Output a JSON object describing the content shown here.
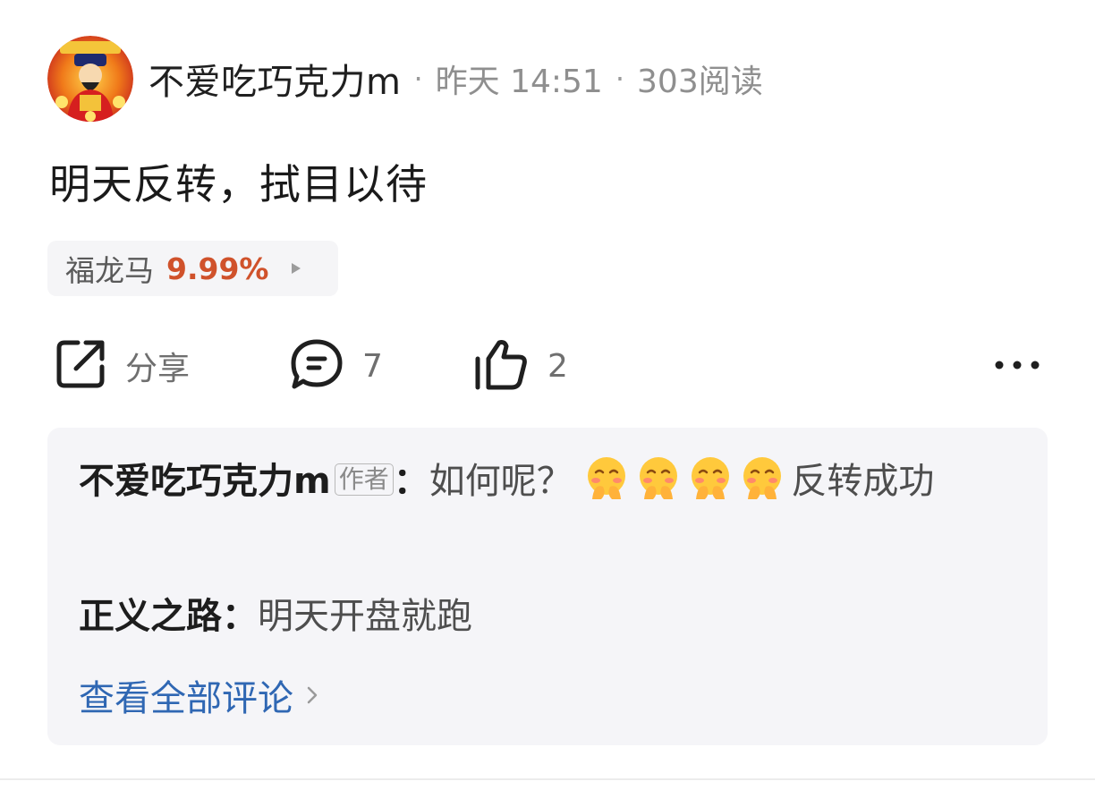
{
  "post": {
    "author": "不爱吃巧克力m",
    "separator": "·",
    "time": "昨天 14:51",
    "reads": "303阅读",
    "content": "明天反转，拭目以待"
  },
  "stock": {
    "name": "福龙马",
    "change": "9.99%",
    "change_color": "#d0522b"
  },
  "actions": {
    "share_label": "分享",
    "comment_count": "7",
    "like_count": "2"
  },
  "comments": [
    {
      "author": "不爱吃巧克力m",
      "badge": "作者",
      "colon": "：",
      "text_before": "如何呢？",
      "emoji": "shy-face-emoji",
      "emoji_count": 4,
      "text_after": "反转成功"
    },
    {
      "author": "正义之路",
      "colon": "：",
      "text": "明天开盘就跑"
    }
  ],
  "view_all_comments": "查看全部评论",
  "colors": {
    "link": "#2f67b3",
    "panel_bg": "#f5f5f8"
  }
}
